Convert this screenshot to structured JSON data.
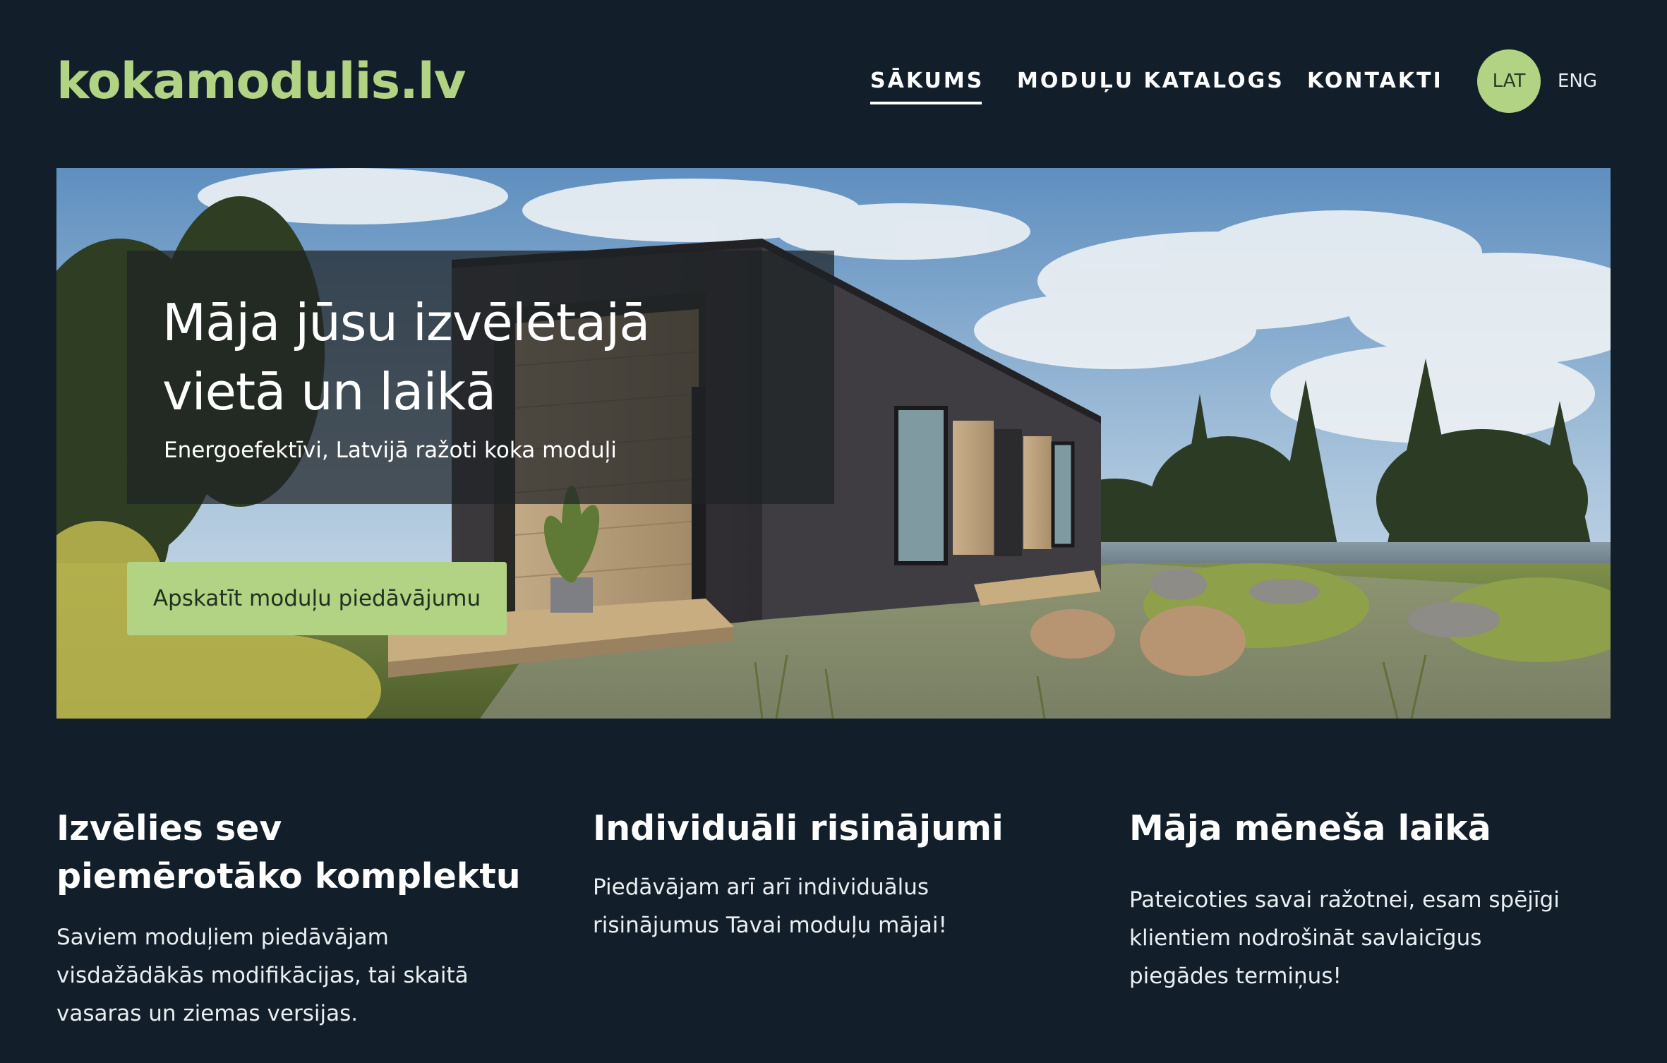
{
  "header": {
    "logo": "kokamodulis.lv",
    "nav": [
      {
        "label": "SĀKUMS",
        "active": true
      },
      {
        "label": "MODUĻU KATALOGS",
        "active": false
      },
      {
        "label": "KONTAKTI",
        "active": false
      }
    ],
    "languages": [
      {
        "label": "LAT",
        "active": true
      },
      {
        "label": "ENG",
        "active": false
      }
    ]
  },
  "hero": {
    "title_line1": "Māja jūsu izvēlētajā",
    "title_line2": "vietā un laikā",
    "subtitle": "Energoefektīvi, Latvijā ražoti koka moduļi",
    "button_label": "Apskatīt moduļu piedāvājumu"
  },
  "features": [
    {
      "title": "Izvēlies sev piemērotāko komplektu",
      "text": "Saviem moduļiem piedāvājam visdažādākās modifikācijas, tai skaitā vasaras un ziemas versijas."
    },
    {
      "title": "Individuāli risinājumi",
      "text": "Piedāvājam arī arī individuālus risinājumus Tavai moduļu mājai!"
    },
    {
      "title": "Māja mēneša laikā",
      "text": "Pateicoties savai ražotnei, esam spējīgi klientiem nodrošināt savlaicīgus piegādes termiņus!"
    }
  ],
  "colors": {
    "background": "#121e29",
    "accent": "#b1d383",
    "text": "#ffffff"
  }
}
